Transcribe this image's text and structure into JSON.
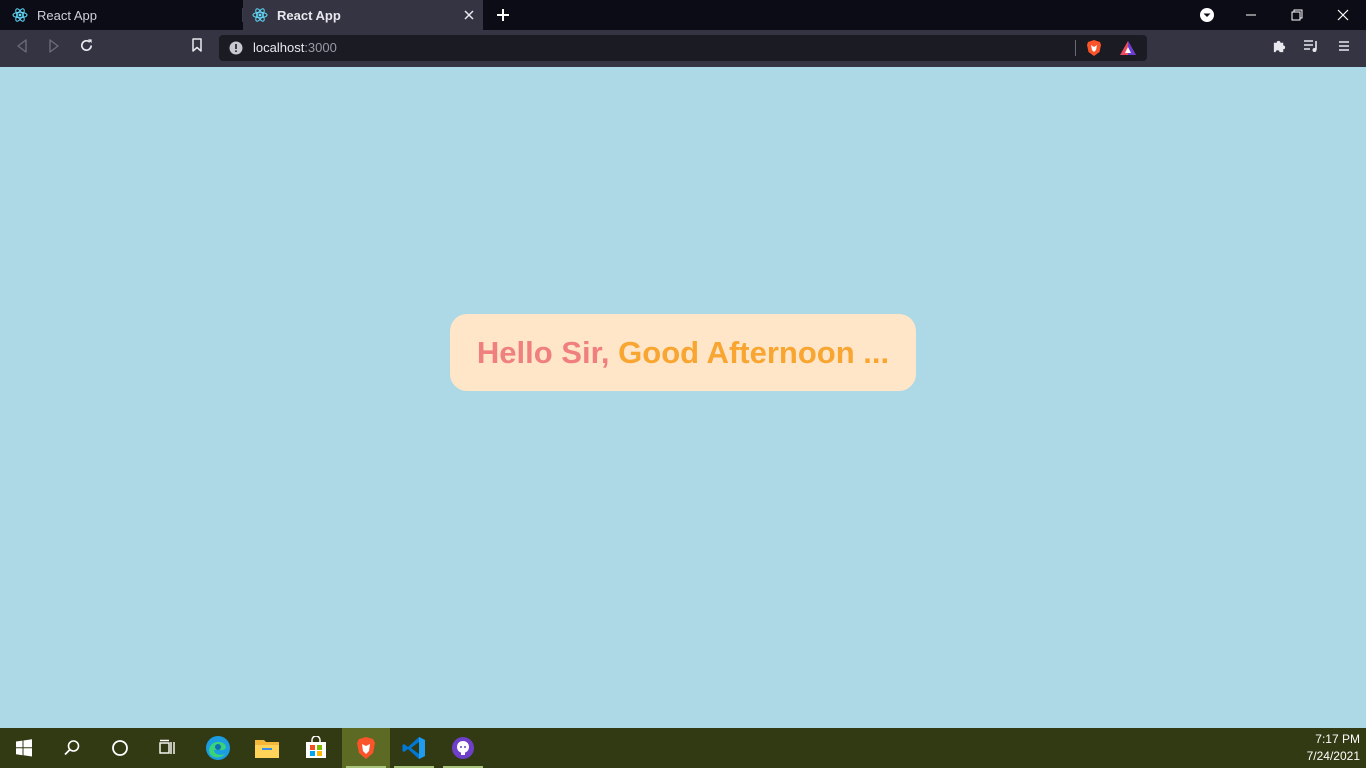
{
  "browser": {
    "tabs": [
      {
        "title": "React App",
        "favicon": "react-icon",
        "active": false
      },
      {
        "title": "React App",
        "favicon": "react-icon",
        "active": true
      }
    ],
    "address": {
      "host": "localhost",
      "port": ":3000"
    },
    "icons": {
      "back": "arrow-left-icon",
      "forward": "arrow-right-icon",
      "reload": "reload-icon",
      "bookmark": "bookmark-icon",
      "site_info": "info-icon",
      "shields": "brave-shield-icon",
      "rewards": "brave-rewards-icon",
      "extensions": "puzzle-icon",
      "media": "playlist-icon",
      "menu": "hamburger-icon",
      "profile": "profile-dropdown-icon",
      "minimize": "minimize-icon",
      "restore": "restore-icon",
      "close": "close-icon"
    }
  },
  "page": {
    "background": "#add8e6",
    "card_background": "#ffe6c9",
    "greeting_hello": "Hello Sir, ",
    "greeting_time": "Good Afternoon ...",
    "hello_color": "#f08080",
    "time_color": "#f8a531"
  },
  "taskbar": {
    "apps": [
      "windows-start-icon",
      "search-icon",
      "cortana-icon",
      "task-view-icon",
      "edge-icon",
      "file-explorer-icon",
      "store-icon",
      "brave-icon",
      "vscode-icon",
      "github-desktop-icon"
    ],
    "time": "7:17 PM",
    "date": "7/24/2021"
  }
}
